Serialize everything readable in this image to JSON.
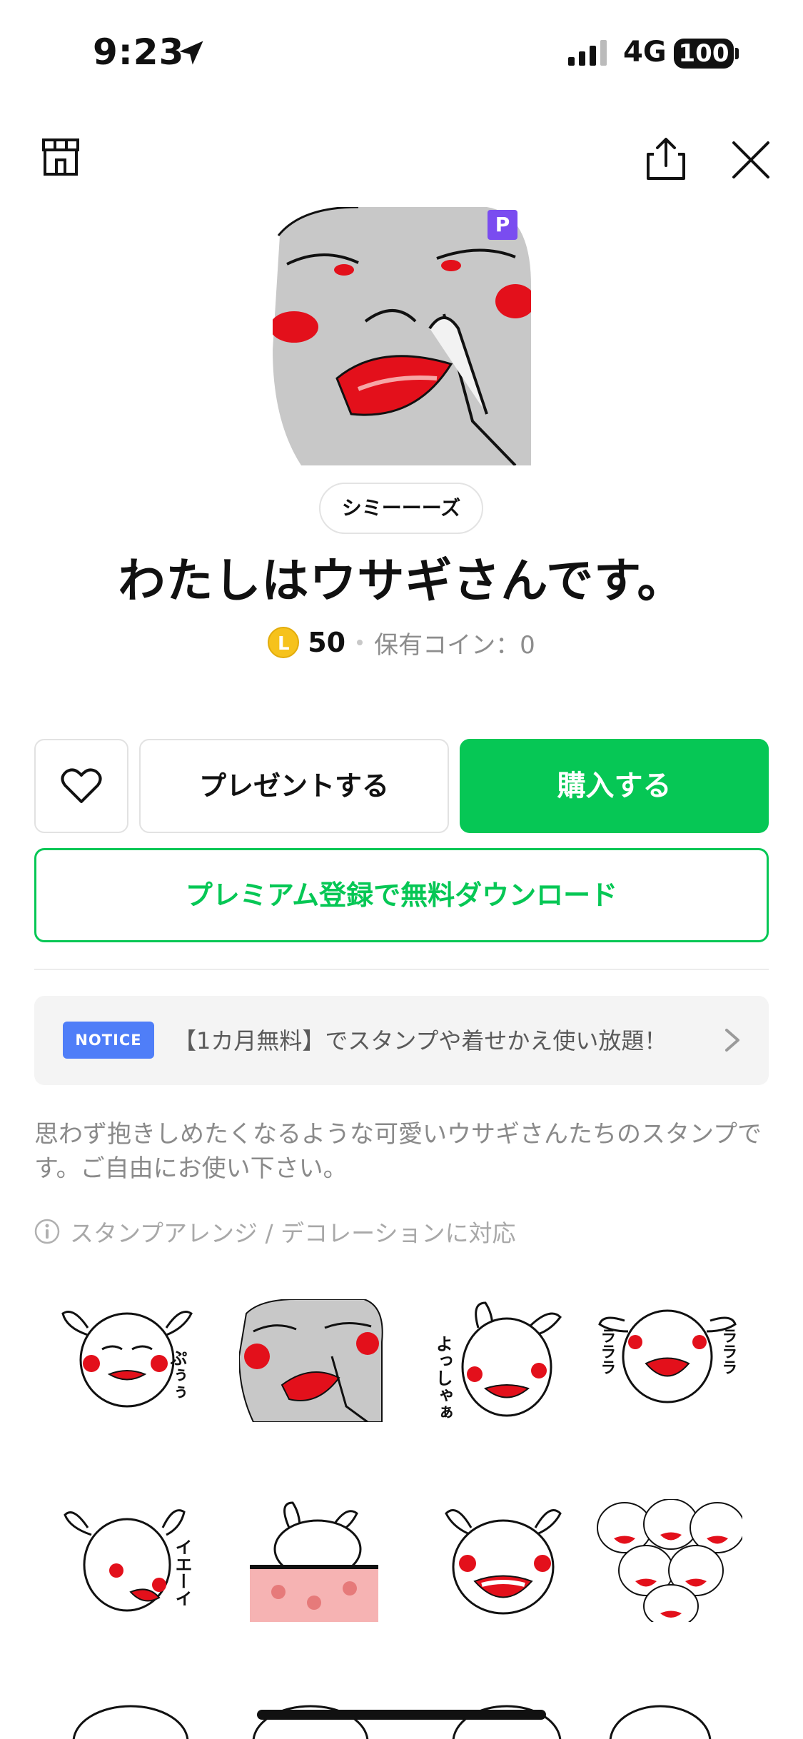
{
  "status_bar": {
    "time": "9:23",
    "network": "4G",
    "battery": "100"
  },
  "header": {
    "shop_icon": "shop-icon",
    "share_icon": "share-icon",
    "close_icon": "close-icon"
  },
  "pack": {
    "premium_badge": "P",
    "author": "シミーーーズ",
    "title": "わたしはウサギさんです。",
    "coin_symbol": "L",
    "price": "50",
    "owned_coins": "保有コイン：0"
  },
  "actions": {
    "present_label": "プレゼントする",
    "buy_label": "購入する",
    "premium_download_label": "プレミアム登録で無料ダウンロード"
  },
  "notice": {
    "badge": "NOTICE",
    "text": "【1カ月無料】でスタンプや着せかえ使い放題！"
  },
  "description": "思わず抱きしめたくなるような可愛いウサギさんたちのスタンプです。ご自由にお使い下さい。",
  "feature": "スタンプアレンジ / デコレーションに対応",
  "stickers": {
    "s1_text": "ぷぅぅ",
    "s3_text": "よっしゃぁ",
    "s4_text": "ラララ",
    "s5_text": "イエーイ"
  },
  "colors": {
    "line_green": "#06c755",
    "notice_blue": "#4f7ef8",
    "premium_purple": "#7a4cf0",
    "accent_red": "#e3101b"
  }
}
